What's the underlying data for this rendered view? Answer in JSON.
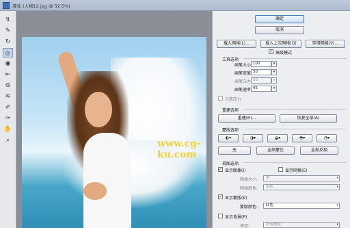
{
  "window": {
    "title": "液化 (人物12.jpg @ 52.5%)"
  },
  "tools": [
    "warp-forward",
    "reconstruct",
    "twirl",
    "pucker",
    "bloat",
    "push-left",
    "mirror",
    "turbulence",
    "freeze-mask",
    "thaw-mask",
    "hand",
    "zoom"
  ],
  "actions": {
    "ok": "确定",
    "cancel": "取消"
  },
  "mesh": {
    "load": "载入网格(L)...",
    "load_last": "载入上次网格(O)",
    "save": "存储网格(V)..."
  },
  "advanced_mode": "高级模式",
  "tool_options": {
    "title": "工具选项",
    "brush_size_label": "画笔大小:",
    "brush_size": "100",
    "brush_density_label": "画笔密度:",
    "brush_density": "50",
    "brush_pressure_label": "画笔压力:",
    "brush_pressure": "50",
    "brush_rate_label": "画笔速率:",
    "brush_rate": "45",
    "stylus_label": "光笔压力"
  },
  "reconstruct_options": {
    "title": "重建选项",
    "reconstruct_btn": "重建(R)...",
    "restore_all_btn": "恢复全部(A)"
  },
  "mask_options": {
    "title": "蒙版选项",
    "none_btn": "无",
    "mask_all_btn": "全部蒙住",
    "invert_all_btn": "全部反相"
  },
  "view_options": {
    "title": "视图选项",
    "show_image": "显示图像(I)",
    "show_mesh": "显示网格(E)",
    "mesh_size_label": "网格大小:",
    "mesh_size": "中",
    "mesh_color_label": "网格颜色:",
    "mesh_color": "灰色",
    "show_mask": "显示蒙版(K)",
    "mask_color_label": "蒙版颜色:",
    "mask_color": "红色",
    "show_backdrop": "显示背景(P)",
    "use_label": "使用:",
    "use_value": "所有图层"
  },
  "canvas": {
    "watermark": "www.cg-ku.com"
  },
  "colors": {
    "primary_btn": "#cddff4",
    "panel_bg": "#eceef1",
    "canvas_bg": "#8a8f97"
  }
}
